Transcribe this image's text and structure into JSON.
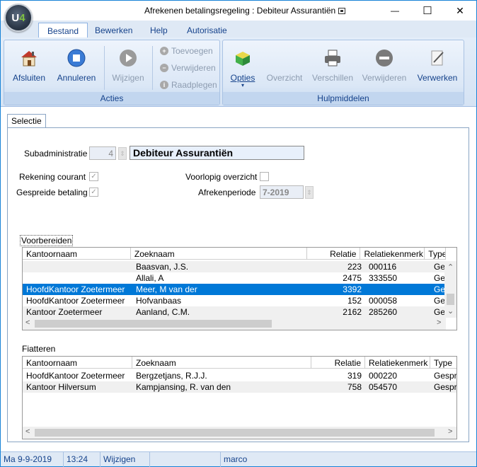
{
  "window": {
    "title": "Afrekenen betalingsregeling : Debiteur Assurantiën",
    "logo_u": "U",
    "logo_4": "4",
    "min_glyph": "—",
    "max_glyph": "☐",
    "close_glyph": "✕"
  },
  "menu": {
    "tabs": [
      "Bestand",
      "Bewerken",
      "Help",
      "Autorisatie"
    ],
    "active": "Bestand"
  },
  "ribbon": {
    "groups": {
      "acties": "Acties",
      "hulpmiddelen": "Hulpmiddelen"
    },
    "buttons": {
      "afsluiten": "Afsluiten",
      "annuleren": "Annuleren",
      "wijzigen": "Wijzigen",
      "toevoegen": "Toevoegen",
      "verwijderen_small": "Verwijderen",
      "raadplegen": "Raadplegen",
      "opties": "Opties",
      "overzicht": "Overzicht",
      "verschillen": "Verschillen",
      "verwijderen": "Verwijderen",
      "verwerken": "Verwerken"
    }
  },
  "tab": {
    "selectie": "Selectie"
  },
  "form": {
    "subadministratie_label": "Subadministratie",
    "subadministratie_nr": "4",
    "subadministratie_naam": "Debiteur Assurantiën",
    "rekening_courant_label": "Rekening courant",
    "gespreide_betaling_label": "Gespreide betaling",
    "voorlopig_overzicht_label": "Voorlopig overzicht",
    "afrekenperiode_label": "Afrekenperiode",
    "afrekenperiode": "7-2019",
    "checkmark": "✓"
  },
  "voorbereiden": {
    "label": "Voorbereiden",
    "columns": [
      "Kantoornaam",
      "Zoeknaam",
      "Relatie",
      "Relatiekenmerk",
      "Type"
    ],
    "rows": [
      [
        "",
        "Baasvan, J.S.",
        "223",
        "000116",
        "Ge"
      ],
      [
        "",
        "Allali, A",
        "2475",
        "333550",
        "Ge"
      ],
      [
        "HoofdKantoor Zoetermeer",
        "Meer, M van der",
        "3392",
        "",
        "Ge"
      ],
      [
        "HoofdKantoor Zoetermeer",
        "Hofvanbaas",
        "152",
        "000058",
        "Ge"
      ],
      [
        "Kantoor Zoetermeer",
        "Aanland, C.M.",
        "2162",
        "285260",
        "Ge"
      ]
    ]
  },
  "fiatteren": {
    "label": "Fiatteren",
    "columns": [
      "Kantoornaam",
      "Zoeknaam",
      "Relatie",
      "Relatiekenmerk",
      "Type"
    ],
    "rows": [
      [
        "HoofdKantoor Zoetermeer",
        "Bergzetjans, R.J.J.",
        "319",
        "000220",
        "Gespre"
      ],
      [
        "Kantoor Hilversum",
        "Kampjansing, R. van den",
        "758",
        "054570",
        "Gespre"
      ]
    ]
  },
  "status": {
    "date": "Ma  9-9-2019",
    "time": "13:24",
    "mode": "Wijzigen",
    "empty": "",
    "user": "marco"
  }
}
